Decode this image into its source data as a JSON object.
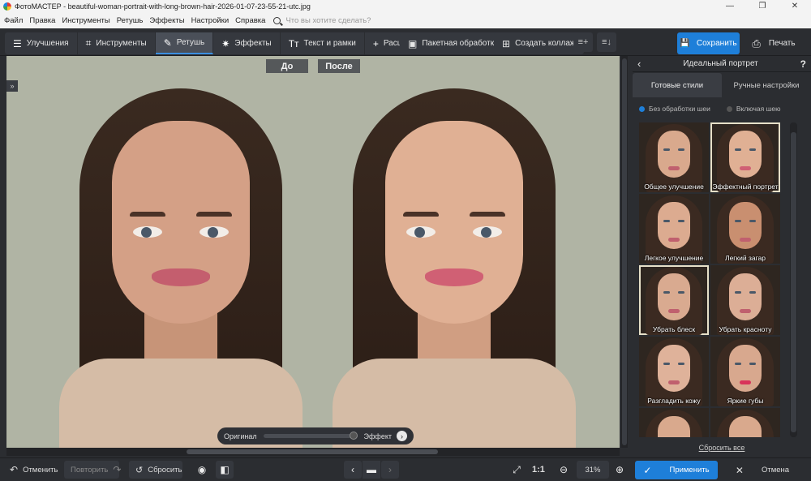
{
  "window": {
    "title": "ФотоМАСТЕР - beautiful-woman-portrait-with-long-brown-hair-2026-01-07-23-55-21-utc.jpg"
  },
  "menu": {
    "items": [
      "Файл",
      "Правка",
      "Инструменты",
      "Ретушь",
      "Эффекты",
      "Настройки",
      "Справка"
    ],
    "search_placeholder": "Что вы хотите сделать?"
  },
  "toolbar": {
    "tabs": [
      {
        "label": "Улучшения",
        "icon": "sliders-icon"
      },
      {
        "label": "Инструменты",
        "icon": "crop-icon"
      },
      {
        "label": "Ретушь",
        "icon": "brush-icon",
        "active": true
      },
      {
        "label": "Эффекты",
        "icon": "magic-wand-icon"
      },
      {
        "label": "Текст и рамки",
        "icon": "text-icon"
      },
      {
        "label": "Расширения",
        "icon": "plus-icon"
      }
    ],
    "batch_label": "Пакетная обработка",
    "collage_label": "Создать коллаж",
    "save_label": "Сохранить",
    "print_label": "Печать"
  },
  "canvas": {
    "before_label": "До",
    "after_label": "После",
    "slider": {
      "left_label": "Оригинал",
      "right_label": "Эффект",
      "value": 1.0
    }
  },
  "panel": {
    "title": "Идеальный портрет",
    "help": "?",
    "tabs": [
      "Готовые стили",
      "Ручные настройки"
    ],
    "active_tab": 0,
    "radio_options": [
      "Без обработки шеи",
      "Включая шею"
    ],
    "radio_selected": 0,
    "presets": [
      "Общее улучшение",
      "Эффектный портрет",
      "Легкое улучшение",
      "Легкий загар",
      "Убрать блеск",
      "Убрать красноту",
      "Разгладить кожу",
      "Яркие губы"
    ],
    "selected_presets": [
      1,
      4
    ],
    "reset_all_label": "Сбросить все"
  },
  "bottom": {
    "undo_label": "Отменить",
    "redo_label": "Повторить",
    "reset_label": "Сбросить",
    "zoom_fit": "1:1",
    "zoom_value": "31%",
    "apply_label": "Применить",
    "cancel_label": "Отмена"
  },
  "colors": {
    "accent": "#1e7fd9",
    "background": "#2b2d31",
    "canvas_bg": "#b0b4a4"
  }
}
